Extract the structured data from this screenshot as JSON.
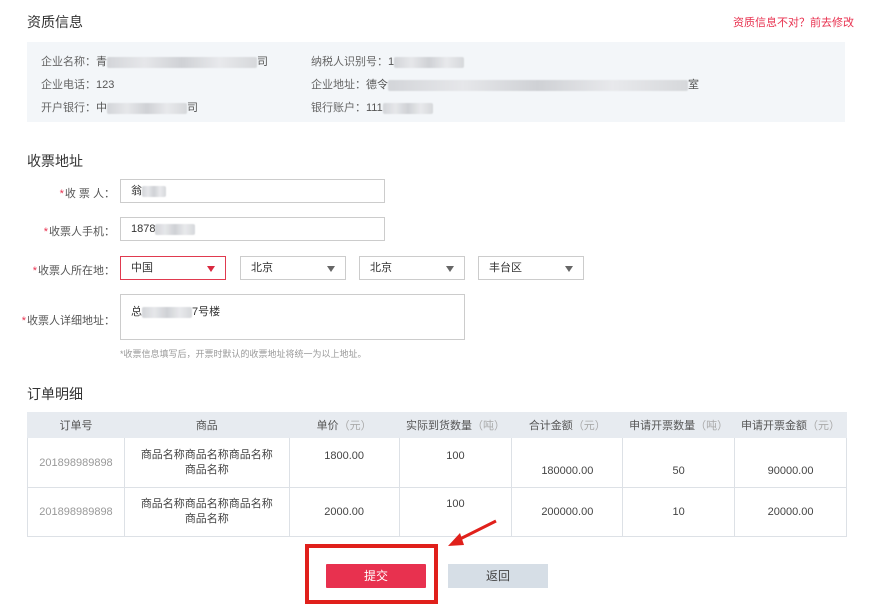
{
  "qualification": {
    "title": "资质信息",
    "edit_link": "资质信息不对？前去修改",
    "company_name_label": "企业名称：",
    "company_name_value_start": "青",
    "company_name_value_end": "司",
    "taxpayer_id_label": "纳税人识别号：",
    "taxpayer_id_value_start": "1",
    "company_phone_label": "企业电话：",
    "company_phone_value": "123",
    "company_address_label": "企业地址：",
    "company_address_value_start": "德令",
    "company_address_value_end": "室",
    "bank_label": "开户银行：",
    "bank_value_start": "中",
    "bank_value_end": "司",
    "account_label": "银行账户：",
    "account_value_start": "111"
  },
  "address": {
    "title": "收票地址",
    "required_mark": "*",
    "recipient_label": "收 票 人：",
    "recipient_value_start": "翁",
    "phone_label": "收票人手机：",
    "phone_value_start": "1878",
    "location_label": "收票人所在地：",
    "country": "中国",
    "province": "北京",
    "city": "北京",
    "district": "丰台区",
    "detail_label": "收票人详细地址：",
    "detail_value_start": "总",
    "detail_value_end": "7号楼",
    "hint": "*收票信息填写后，开票时默认的收票地址将统一为以上地址。"
  },
  "orders": {
    "title": "订单明细",
    "headers": [
      {
        "text": "订单号",
        "unit": ""
      },
      {
        "text": "商品",
        "unit": ""
      },
      {
        "text": "单价",
        "unit": "（元）"
      },
      {
        "text": "实际到货数量",
        "unit": "（吨）"
      },
      {
        "text": "合计金额",
        "unit": "（元）"
      },
      {
        "text": "申请开票数量",
        "unit": "（吨）"
      },
      {
        "text": "申请开票金额",
        "unit": "（元）"
      }
    ],
    "rows": [
      {
        "order_no": "201898989898",
        "product": "商品名称商品名称商品名称商品名称",
        "price": "1800.00",
        "qty": "100",
        "total": "180000.00",
        "inv_qty": "50",
        "inv_amount": "90000.00"
      },
      {
        "order_no": "201898989898",
        "product": "商品名称商品名称商品名称商品名称",
        "price": "2000.00",
        "qty": "100",
        "total": "200000.00",
        "inv_qty": "10",
        "inv_amount": "20000.00"
      }
    ]
  },
  "actions": {
    "submit": "提交",
    "back": "返回"
  },
  "colors": {
    "accent": "#e8314f",
    "annotation": "#e0201b"
  }
}
